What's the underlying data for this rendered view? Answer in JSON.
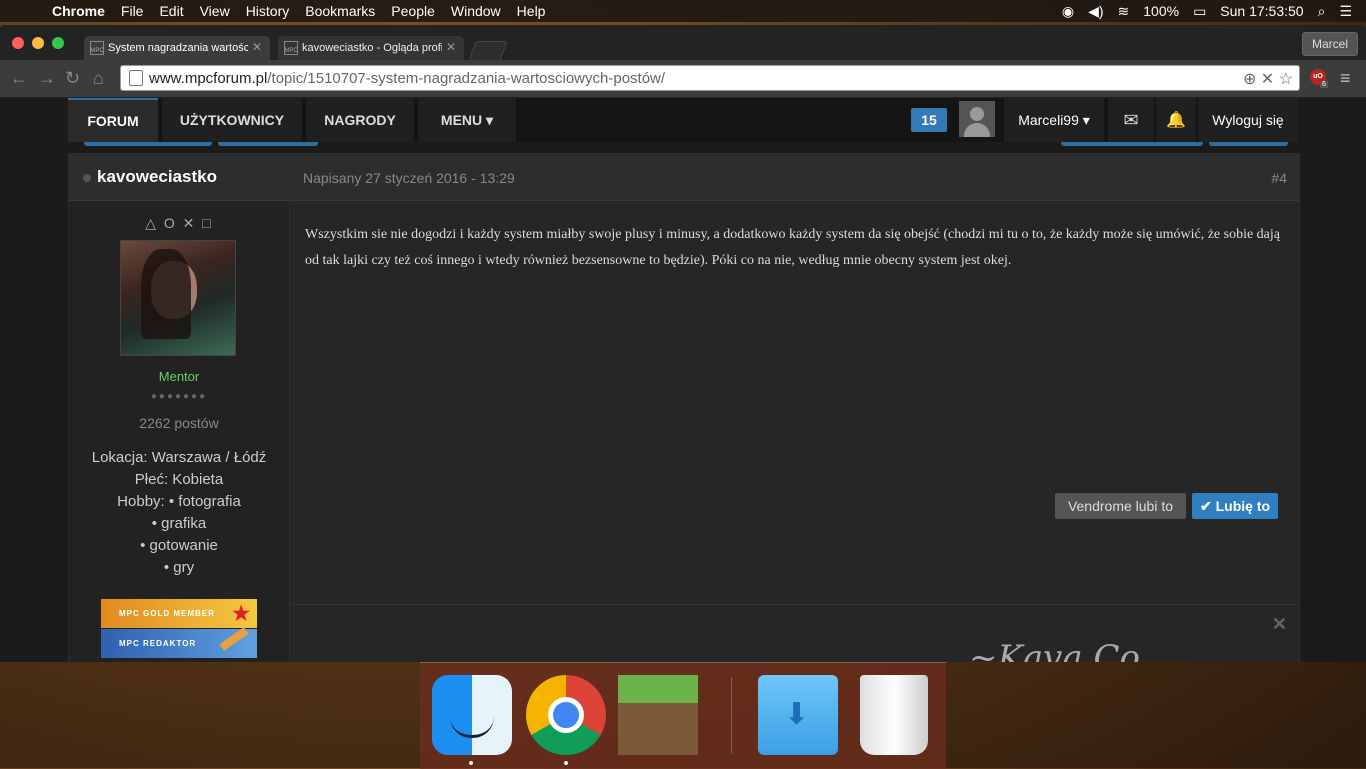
{
  "menubar": {
    "app": "Chrome",
    "items": [
      "File",
      "Edit",
      "View",
      "History",
      "Bookmarks",
      "People",
      "Window",
      "Help"
    ],
    "battery": "100%",
    "clock": "Sun 17:53:50"
  },
  "browser": {
    "tabs": [
      {
        "title": "System nagradzania wartościowych"
      },
      {
        "title": "kavoweciastko - Ogląda profil"
      }
    ],
    "profile": "Marcel",
    "url_domain": "www.mpcforum.pl",
    "url_path": "/topic/1510707-system-nagradzania-wartosciowych-postów/",
    "extension_badge": "6"
  },
  "forum": {
    "nav": [
      "FORUM",
      "UŻYTKOWNICY",
      "NAGRODY",
      "MENU"
    ],
    "notifications": "15",
    "username": "Marceli99",
    "logout": "Wyloguj się"
  },
  "post": {
    "author": "kavoweciastko",
    "date": "Napisany 27 styczeń 2016 - 13:29",
    "number": "#4",
    "user_title": "△ O ✕ □",
    "group": "Mentor",
    "pips": "●●●●●●●",
    "post_count": "2262 postów",
    "info": [
      "Lokacja: Warszawa / Łódź",
      "Płeć: Kobieta",
      "Hobby: • fotografia",
      "• grafika",
      "• gotowanie",
      "• gry"
    ],
    "awards": [
      "MPC GOLD MEMBER",
      "MPC REDAKTOR"
    ],
    "content": "Wszystkim sie nie dogodzi i każdy system miałby swoje plusy i minusy, a dodatkowo każdy system da się obejść (chodzi mi tu o to, że każdy może się umówić, że sobie dają od tak lajki czy też coś innego i wtedy również bezsensowne to będzie). Póki co na nie, według mnie obecny system jest okej.",
    "likes_text": "Vendrome lubi to",
    "like_button": "✔ Lubię to"
  }
}
